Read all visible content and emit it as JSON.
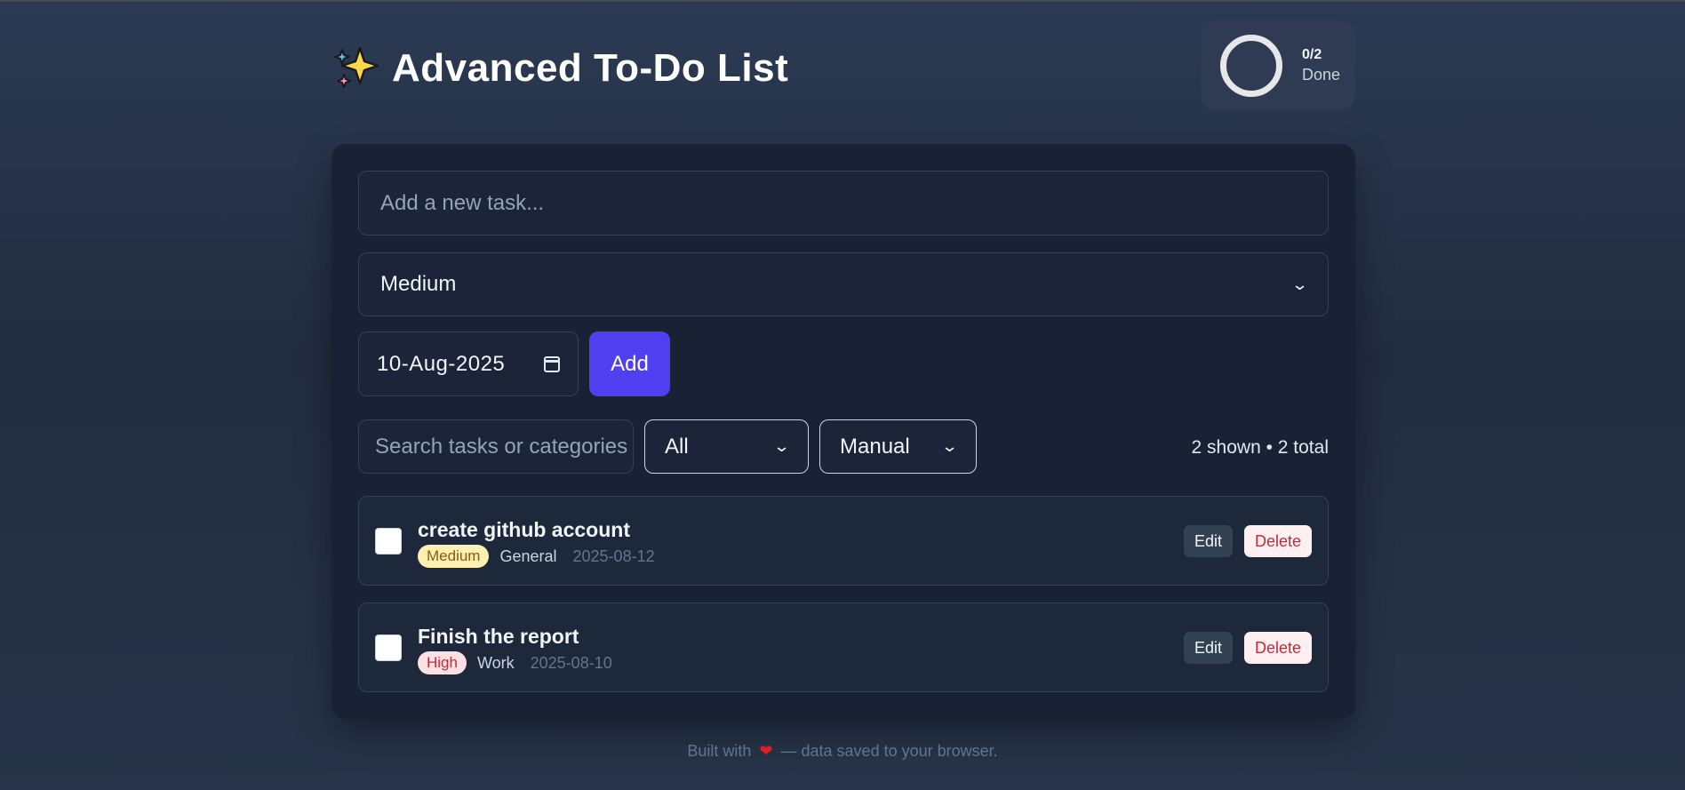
{
  "header": {
    "title": "Advanced To-Do List",
    "icon": "sparkles-icon"
  },
  "progress": {
    "count": "0/2",
    "label": "Done",
    "fraction": 0
  },
  "form": {
    "task_placeholder": "Add a new task...",
    "priority_value": "Medium",
    "date_value": "10-Aug-2025",
    "add_label": "Add"
  },
  "toolbar": {
    "search_placeholder": "Search tasks or categories",
    "filter_value": "All",
    "sort_value": "Manual",
    "counts": "2 shown • 2 total"
  },
  "tasks": [
    {
      "title": "create github account",
      "priority": "Medium",
      "category": "General",
      "due": "2025-08-12",
      "edit_label": "Edit",
      "delete_label": "Delete",
      "done": false
    },
    {
      "title": "Finish the report",
      "priority": "High",
      "category": "Work",
      "due": "2025-08-10",
      "edit_label": "Edit",
      "delete_label": "Delete",
      "done": false
    }
  ],
  "footer": {
    "prefix": "Built with",
    "suffix": "— data saved to your browser."
  },
  "colors": {
    "accent": "#4f3ff0",
    "medium_badge": "#fdf0b0",
    "high_badge": "#fde0e2"
  }
}
